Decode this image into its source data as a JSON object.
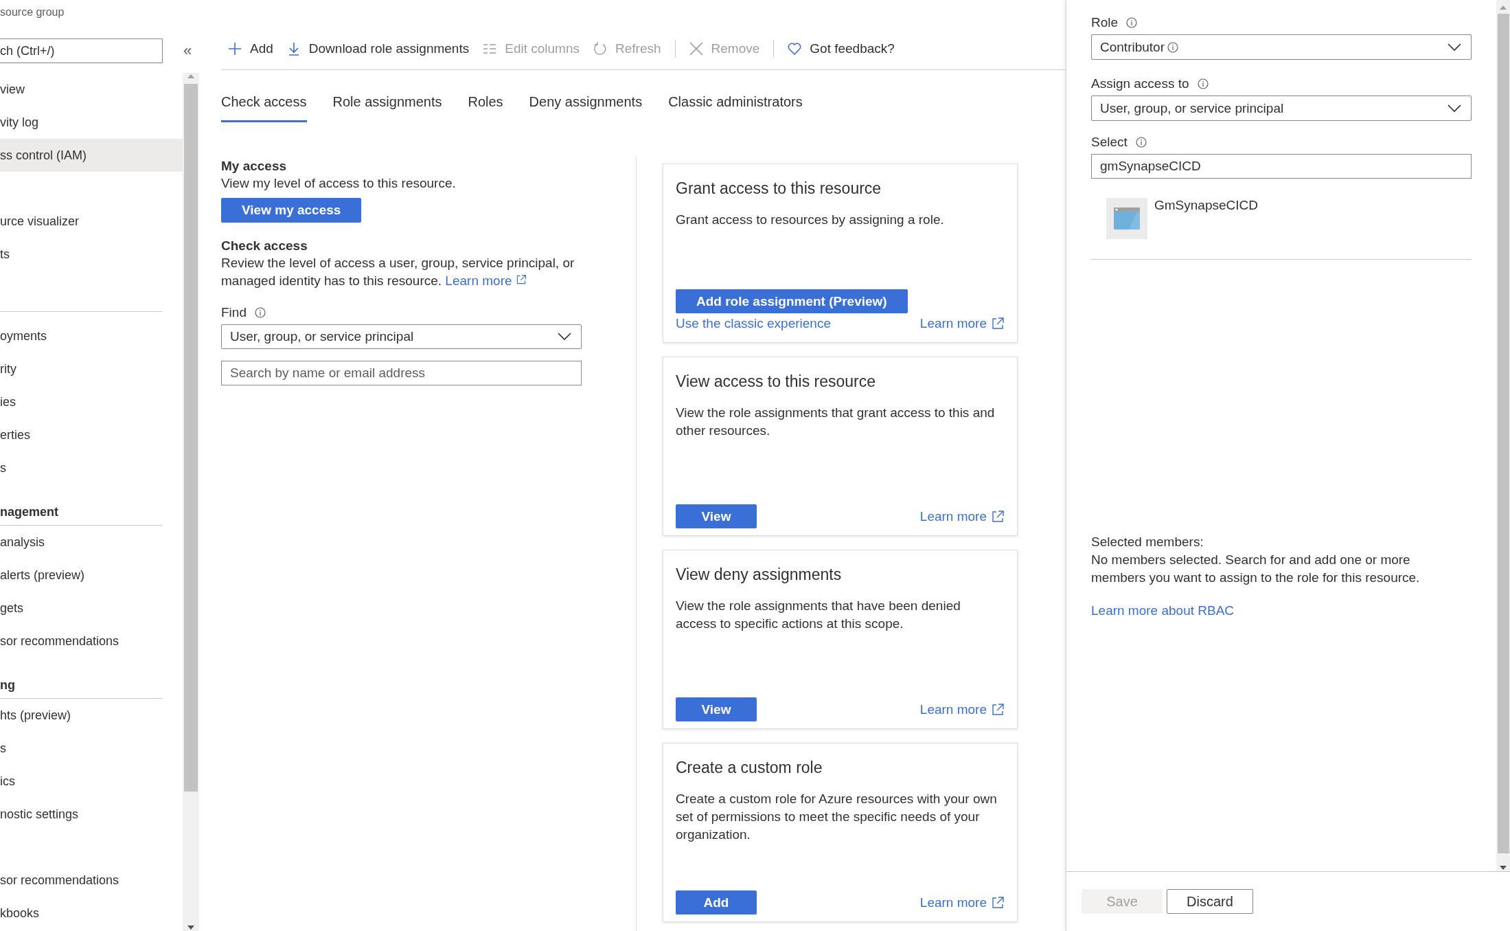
{
  "header": {
    "subtitle": "source group"
  },
  "sidebar": {
    "search": {
      "value": "ch (Ctrl+/)"
    },
    "collapse": "«",
    "sections": [
      {
        "divider": false,
        "items": [
          {
            "label": "view",
            "selected": false
          },
          {
            "label": "vity log",
            "selected": false
          },
          {
            "label": "ss control (IAM)",
            "selected": true
          }
        ]
      },
      {
        "divider": false,
        "items": [
          {
            "label": "urce visualizer",
            "selected": false
          },
          {
            "label": "ts",
            "selected": false
          }
        ]
      },
      {
        "divider": true,
        "items": [
          {
            "label": "oyments",
            "selected": false
          },
          {
            "label": "rity",
            "selected": false
          },
          {
            "label": "ies",
            "selected": false
          },
          {
            "label": "erties",
            "selected": false
          },
          {
            "label": "s",
            "selected": false
          }
        ]
      },
      {
        "divider": true,
        "header": "nagement",
        "items": [
          {
            "label": "analysis",
            "selected": false
          },
          {
            "label": "alerts (preview)",
            "selected": false
          },
          {
            "label": "gets",
            "selected": false
          },
          {
            "label": "sor recommendations",
            "selected": false
          }
        ]
      },
      {
        "divider": true,
        "header": "ng",
        "items": [
          {
            "label": "hts (preview)",
            "selected": false
          },
          {
            "label": "s",
            "selected": false
          },
          {
            "label": "ics",
            "selected": false
          },
          {
            "label": "nostic settings",
            "selected": false
          }
        ]
      },
      {
        "divider": false,
        "items": [
          {
            "label": "sor recommendations",
            "selected": false
          },
          {
            "label": "kbooks",
            "selected": false
          }
        ]
      }
    ]
  },
  "toolbar": [
    {
      "kind": "add",
      "label": "Add",
      "disabled": false
    },
    {
      "kind": "download",
      "label": "Download role assignments",
      "disabled": false
    },
    {
      "kind": "columns",
      "label": "Edit columns",
      "disabled": true
    },
    {
      "kind": "refresh",
      "label": "Refresh",
      "disabled": true
    },
    {
      "kind": "remove",
      "label": "Remove",
      "disabled": true
    },
    {
      "kind": "feedback",
      "label": "Got feedback?",
      "disabled": false
    }
  ],
  "tabs": [
    {
      "label": "Check access",
      "selected": true
    },
    {
      "label": "Role assignments",
      "selected": false
    },
    {
      "label": "Roles",
      "selected": false
    },
    {
      "label": "Deny assignments",
      "selected": false
    },
    {
      "label": "Classic administrators",
      "selected": false
    }
  ],
  "check_access": {
    "my_access": {
      "title": "My access",
      "description": "View my level of access to this resource.",
      "button": "View my access"
    },
    "check": {
      "title": "Check access",
      "description": "Review the level of access a user, group, service principal, or managed identity has to this resource.",
      "link": "Learn more"
    },
    "find": {
      "label": "Find",
      "dropdown": "User, group, or service principal",
      "placeholder": "Search by name or email address"
    }
  },
  "cards": [
    {
      "title": "Grant access to this resource",
      "description": "Grant access to resources by assigning a role.",
      "button": "Add role assignment (Preview)",
      "secondary_link": "Use the classic experience",
      "learn_more": "Learn more"
    },
    {
      "title": "View access to this resource",
      "description": "View the role assignments that grant access to this and other resources.",
      "button": "View",
      "learn_more": "Learn more"
    },
    {
      "title": "View deny assignments",
      "description": "View the role assignments that have been denied access to specific actions at this scope.",
      "button": "View",
      "learn_more": "Learn more"
    },
    {
      "title": "Create a custom role",
      "description": "Create a custom role for Azure resources with your own set of permissions to meet the specific needs of your organization.",
      "button": "Add",
      "learn_more": "Learn more"
    }
  ],
  "panel": {
    "role": {
      "label": "Role",
      "value": "Contributor"
    },
    "assign": {
      "label": "Assign access to",
      "value": "User, group, or service principal"
    },
    "select": {
      "label": "Select",
      "value": "gmSynapseCICD"
    },
    "results": [
      {
        "name": "GmSynapseCICD"
      }
    ],
    "selected_members": {
      "label": "Selected members:",
      "text": "No members selected. Search for and add one or more members you want to assign to the role for this resource."
    },
    "rbac_link": "Learn more about RBAC",
    "buttons": [
      {
        "label": "Save",
        "disabled": true
      },
      {
        "label": "Discard",
        "disabled": false
      }
    ]
  }
}
